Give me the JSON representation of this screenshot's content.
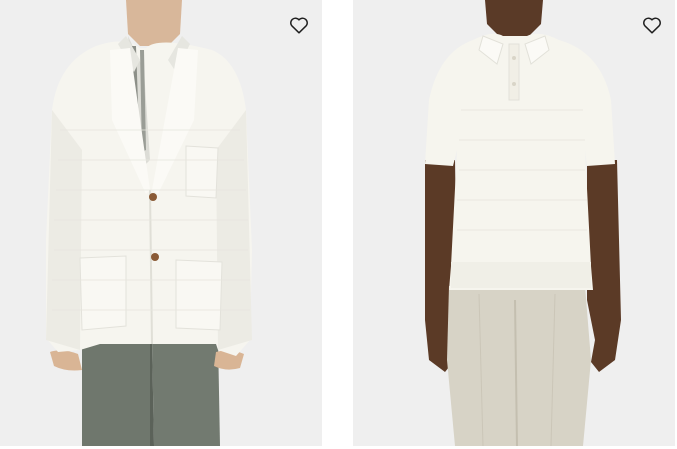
{
  "products": [
    {
      "image_alt": "",
      "wishlist_icon": "heart-outline-icon"
    },
    {
      "image_alt": "",
      "wishlist_icon": "heart-outline-icon"
    }
  ],
  "colors": {
    "card_bg": "#efefef",
    "icon_stroke": "#1f1f1f"
  }
}
